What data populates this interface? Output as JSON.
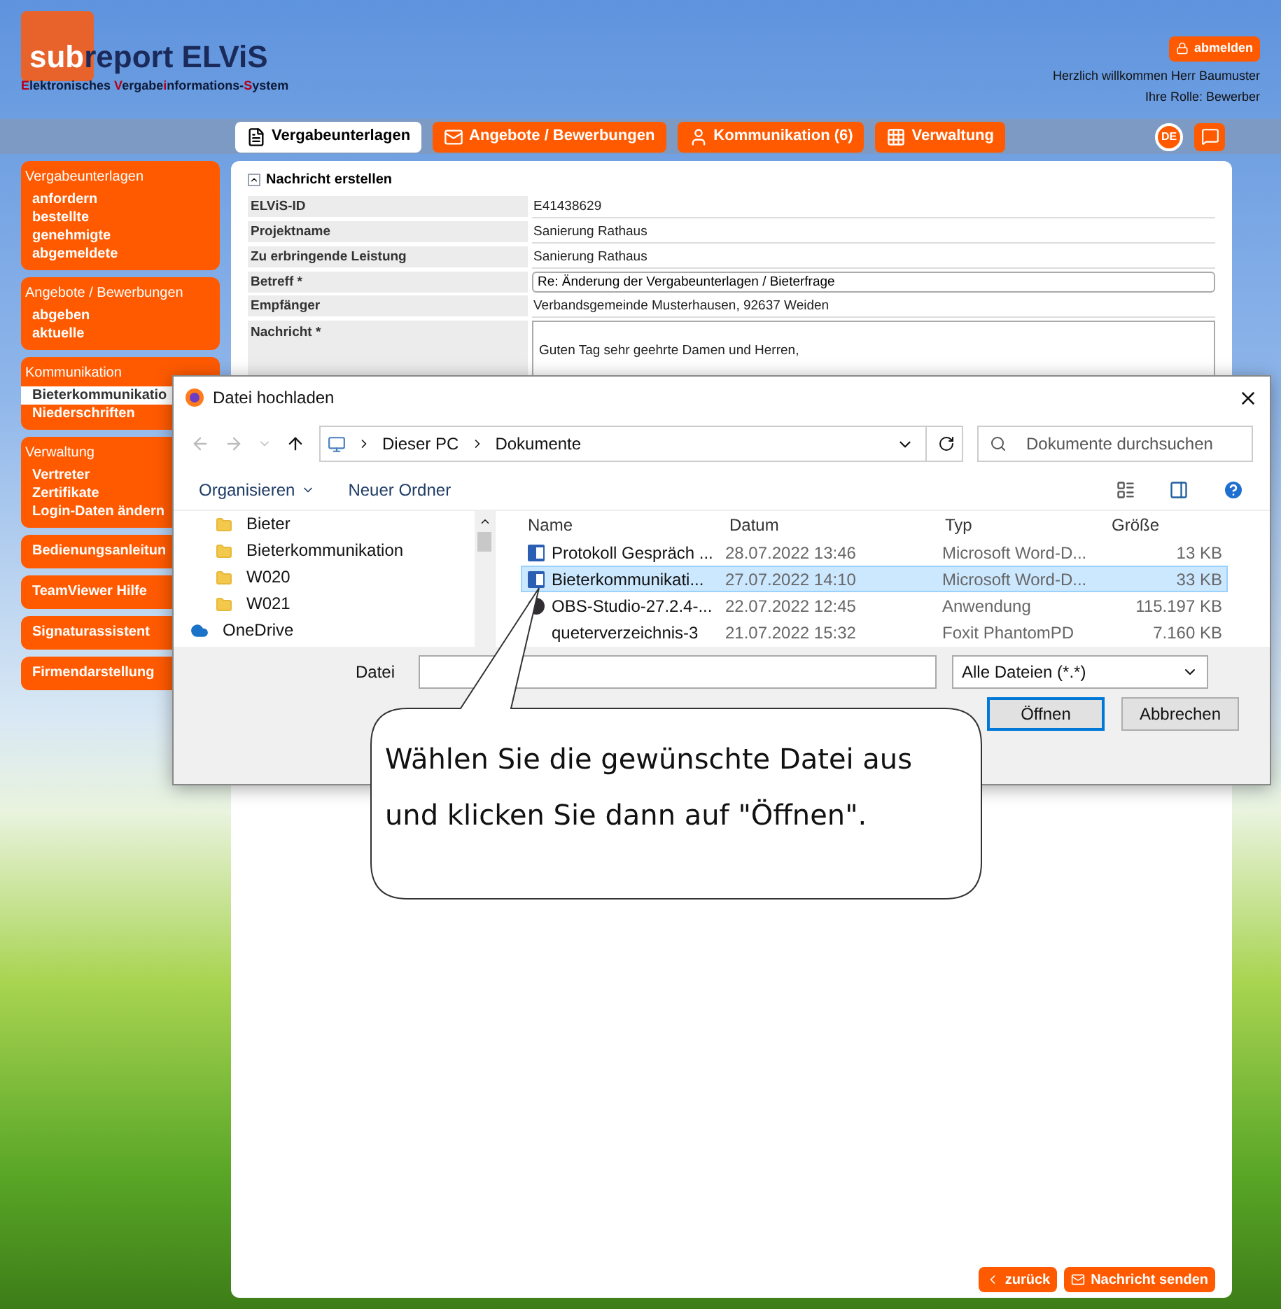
{
  "header": {
    "logo_highlight": "sub",
    "logo_rest": "report ELViS",
    "tagline": [
      {
        "text": "E",
        "accent": true
      },
      {
        "text": "lektronisches ",
        "accent": false
      },
      {
        "text": "V",
        "accent": true
      },
      {
        "text": "ergabe",
        "accent": false
      },
      {
        "text": "i",
        "accent": true
      },
      {
        "text": "nformations-",
        "accent": false
      },
      {
        "text": "S",
        "accent": true
      },
      {
        "text": "ystem",
        "accent": false
      }
    ],
    "logout": "abmelden",
    "welcome": "Herzlich willkommen Herr Baumuster",
    "role": "Ihre Rolle: Bewerber",
    "language": "DE"
  },
  "nav_tabs": [
    {
      "label": "Vergabeunterlagen",
      "selected": true,
      "kind": "document"
    },
    {
      "label": "Angebote / Bewerbungen",
      "selected": false,
      "kind": "envelope"
    },
    {
      "label": "Kommunikation (6)",
      "selected": false,
      "kind": "person"
    },
    {
      "label": "Verwaltung",
      "selected": false,
      "kind": "grid"
    }
  ],
  "sidebar": [
    {
      "title": "Vergabeunterlagen",
      "items": [
        {
          "label": "anfordern",
          "selected": false
        },
        {
          "label": "bestellte",
          "selected": false
        },
        {
          "label": "genehmigte",
          "selected": false
        },
        {
          "label": "abgemeldete",
          "selected": false
        }
      ]
    },
    {
      "title": "Angebote / Bewerbungen",
      "items": [
        {
          "label": "abgeben",
          "selected": false
        },
        {
          "label": "aktuelle",
          "selected": false
        }
      ]
    },
    {
      "title": "Kommunikation",
      "items": [
        {
          "label": "Bieterkommunikatio",
          "selected": true
        },
        {
          "label": "Niederschriften",
          "selected": false
        }
      ]
    },
    {
      "title": "Verwaltung",
      "items": [
        {
          "label": "Vertreter",
          "selected": false
        },
        {
          "label": "Zertifikate",
          "selected": false
        },
        {
          "label": "Login-Daten ändern",
          "selected": false
        }
      ]
    },
    {
      "title": "Bedienungsanleitun"
    },
    {
      "title": "TeamViewer Hilfe"
    },
    {
      "title": "Signaturassistent"
    },
    {
      "title": "Firmendarstellung"
    }
  ],
  "form": {
    "title": "Nachricht erstellen",
    "fields": [
      {
        "label": "ELViS-ID",
        "kind": "text",
        "value": "E41438629"
      },
      {
        "label": "Projektname",
        "kind": "text",
        "value": "Sanierung Rathaus"
      },
      {
        "label": "Zu erbringende Leistung",
        "kind": "text",
        "value": "Sanierung Rathaus"
      },
      {
        "label": "Betreff *",
        "kind": "input",
        "value": "Re: Änderung der Vergabeunterlagen / Bieterfrage"
      },
      {
        "label": "Empfänger",
        "kind": "text",
        "value": "Verbandsgemeinde Musterhausen, 92637 Weiden"
      },
      {
        "label": "Nachricht *",
        "kind": "textarea",
        "value": "Guten Tag sehr geehrte Damen und Herren,"
      }
    ]
  },
  "footer_buttons": [
    {
      "label": "zurück",
      "kind": "back"
    },
    {
      "label": "Nachricht senden",
      "kind": "send"
    }
  ],
  "dialog": {
    "title": "Datei hochladen",
    "breadcrumb": [
      "Dieser PC",
      "Dokumente"
    ],
    "search_placeholder": "Dokumente durchsuchen",
    "toolbar": [
      {
        "label": "Organisieren",
        "kind": "menu"
      },
      {
        "label": "Neuer Ordner",
        "kind": "plain"
      }
    ],
    "nav_items": [
      {
        "label": "Bieter",
        "kind": "folder"
      },
      {
        "label": "Bieterkommunikation",
        "kind": "folder"
      },
      {
        "label": "W020",
        "kind": "folder"
      },
      {
        "label": "W021",
        "kind": "folder"
      },
      {
        "label": "OneDrive",
        "kind": "cloud"
      }
    ],
    "columns": [
      "Name",
      "Datum",
      "Typ",
      "Größe"
    ],
    "files": [
      {
        "name": "Protokoll Gespräch ...",
        "date": "28.07.2022 13:46",
        "type": "Microsoft Word-D...",
        "size": "13 KB",
        "kind": "word",
        "selected": false
      },
      {
        "name": "Bieterkommunikati...",
        "date": "27.07.2022 14:10",
        "type": "Microsoft Word-D...",
        "size": "33 KB",
        "kind": "word",
        "selected": true
      },
      {
        "name": "OBS-Studio-27.2.4-...",
        "date": "22.07.2022 12:45",
        "type": "Anwendung",
        "size": "115.197 KB",
        "kind": "app",
        "selected": false
      },
      {
        "name": "queterverzeichnis-3",
        "date": "21.07.2022 15:32",
        "type": "Foxit PhantomPD",
        "size": "7.160 KB",
        "kind": "pdf",
        "selected": false
      }
    ],
    "filename_label": "Datei",
    "filter": "Alle Dateien (*.*)",
    "buttons": [
      "Öffnen",
      "Abbrechen"
    ]
  },
  "callout": {
    "text": "Wählen Sie die gewünschte Datei aus und klicken Sie dann auf \"Öffnen\"."
  }
}
